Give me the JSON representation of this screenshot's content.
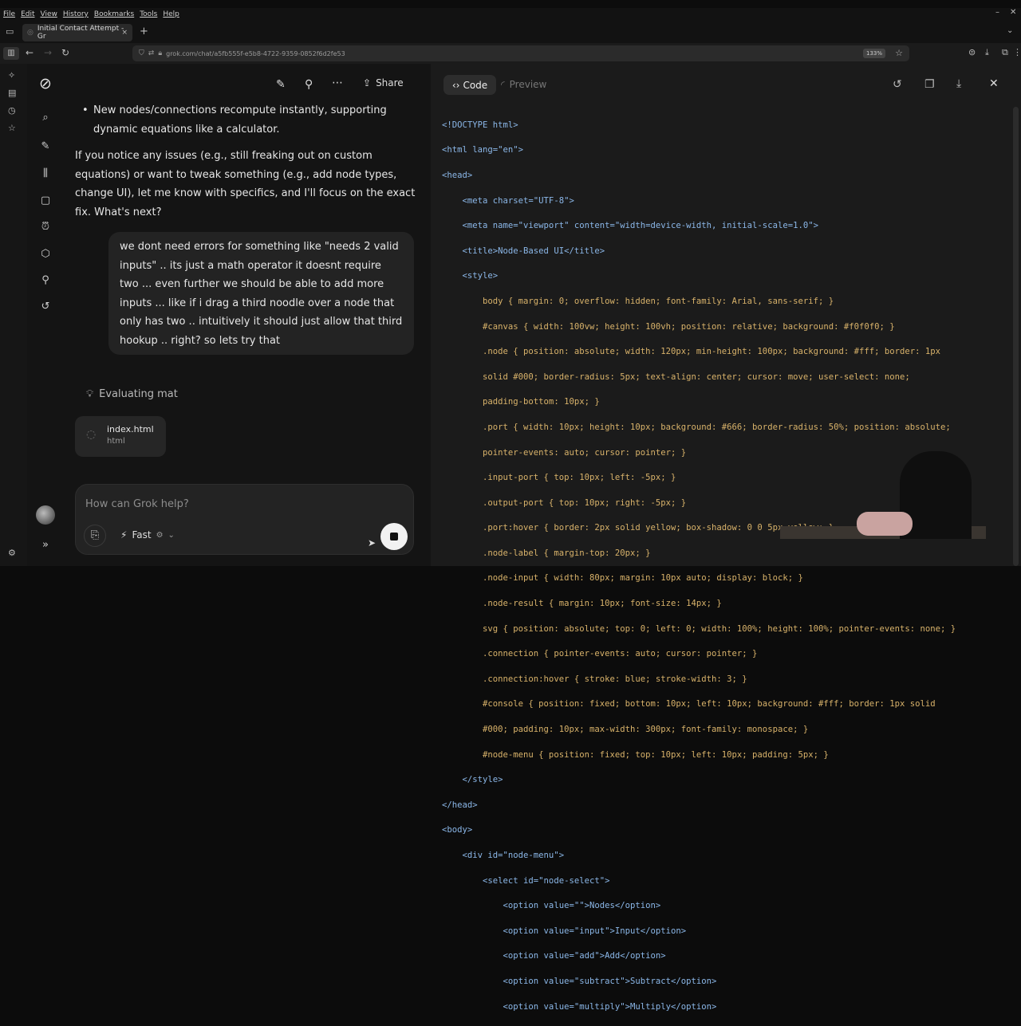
{
  "menu": [
    "File",
    "Edit",
    "View",
    "History",
    "Bookmarks",
    "Tools",
    "Help"
  ],
  "tab": {
    "title": "Initial Contact Attempt - Gr",
    "close": "×",
    "new": "+"
  },
  "url": {
    "text": "grok.com/chat/a5fb555f-e5b8-4722-9359-0852f6d2fe53",
    "zoom": "133%"
  },
  "chat": {
    "share": "Share",
    "bullet": "New nodes/connections recompute instantly, supporting dynamic equations like a calculator.",
    "para": "If you notice any issues (e.g., still freaking out on custom equations) or want to tweak something (e.g., add node types, change UI), let me know with specifics, and I'll focus on the exact fix. What's next?",
    "user_msg": "we dont need errors for something like \"needs 2 valid inputs\" .. its just a math operator it doesnt require two ... even further we should be able to add more inputs ... like if i drag a third noodle over a node that only has two .. intuitively it should just allow that third hookup .. right? so lets try that",
    "status": "Evaluating mat",
    "file_name": "index.html",
    "file_type": "html",
    "input_placeholder": "How can Grok help?",
    "mode": "Fast"
  },
  "code": {
    "tab_code": "Code",
    "tab_preview": "Preview",
    "lines": [
      "<!DOCTYPE html>",
      "<html lang=\"en\">",
      "<head>",
      "    <meta charset=\"UTF-8\">",
      "    <meta name=\"viewport\" content=\"width=device-width, initial-scale=1.0\">",
      "    <title>Node-Based UI</title>",
      "    <style>",
      "        body { margin: 0; overflow: hidden; font-family: Arial, sans-serif; }",
      "        #canvas { width: 100vw; height: 100vh; position: relative; background: #f0f0f0; }",
      "        .node { position: absolute; width: 120px; min-height: 100px; background: #fff; border: 1px",
      "        solid #000; border-radius: 5px; text-align: center; cursor: move; user-select: none;",
      "        padding-bottom: 10px; }",
      "        .port { width: 10px; height: 10px; background: #666; border-radius: 50%; position: absolute;",
      "        pointer-events: auto; cursor: pointer; }",
      "        .input-port { top: 10px; left: -5px; }",
      "        .output-port { top: 10px; right: -5px; }",
      "        .port:hover { border: 2px solid yellow; box-shadow: 0 0 5px yellow; }",
      "        .node-label { margin-top: 20px; }",
      "        .node-input { width: 80px; margin: 10px auto; display: block; }",
      "        .node-result { margin: 10px; font-size: 14px; }",
      "        svg { position: absolute; top: 0; left: 0; width: 100%; height: 100%; pointer-events: none; }",
      "        .connection { pointer-events: auto; cursor: pointer; }",
      "        .connection:hover { stroke: blue; stroke-width: 3; }",
      "        #console { position: fixed; bottom: 10px; left: 10px; background: #fff; border: 1px solid",
      "        #000; padding: 10px; max-width: 300px; font-family: monospace; }",
      "        #node-menu { position: fixed; top: 10px; left: 10px; padding: 5px; }",
      "    </style>",
      "</head>",
      "<body>",
      "    <div id=\"node-menu\">",
      "        <select id=\"node-select\">",
      "            <option value=\"\">Nodes</option>",
      "            <option value=\"input\">Input</option>",
      "            <option value=\"add\">Add</option>",
      "            <option value=\"subtract\">Subtract</option>",
      "            <option value=\"multiply\">Multiply</option>"
    ]
  }
}
